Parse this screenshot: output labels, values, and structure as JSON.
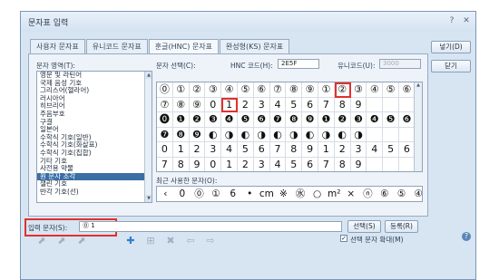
{
  "window": {
    "title": "문자표 입력",
    "help_icon": "?",
    "close_icon": "✕"
  },
  "tabs": [
    {
      "label": "사용자 문자표"
    },
    {
      "label": "유니코드 문자표"
    },
    {
      "label": "훈글(HNC) 문자표"
    },
    {
      "label": "완성형(KS) 문자표"
    }
  ],
  "area_label": "문자 영역(T):",
  "areas": [
    "영문 및 라틴어",
    "국제 음성 기호",
    "그리스어(헬라어)",
    "러시아어",
    "히브리어",
    "주음부호",
    "구결",
    "일본어",
    "수학식 기호(일반)",
    "수학식 기호(화살표)",
    "수학식 기호(집합)",
    "기타 기호",
    "사전용 약물",
    "원 문자 조각",
    "챌린 기호",
    "반각 기호(선)"
  ],
  "selected_area_index": 13,
  "char_select_label": "문자 선택(C):",
  "hnc_code_label": "HNC 코드(H):",
  "hnc_code_value": "2E5F",
  "unicode_label": "유니코드(U):",
  "unicode_value": "3000",
  "grid_rows": [
    [
      "⓪",
      "①",
      "②",
      "③",
      "④",
      "⑤",
      "⑥",
      "⑦",
      "⑧",
      "⑨",
      "①",
      "②",
      "③",
      "④",
      "⑤",
      "⑥"
    ],
    [
      "⑦",
      "⑧",
      "⑨",
      "0",
      "1",
      "2",
      "3",
      "4",
      "5",
      "6",
      "7",
      "8",
      "9",
      "",
      "",
      ""
    ],
    [
      "⓿",
      "❶",
      "❷",
      "❸",
      "❹",
      "❺",
      "❻",
      "❼",
      "❽",
      "❾",
      "❶",
      "❷",
      "❸",
      "❹",
      "❺",
      "❻"
    ],
    [
      "❼",
      "❽",
      "❾",
      "◐",
      "◑",
      "◐",
      "◑",
      "◐",
      "◑",
      "◐",
      "◑",
      "◐",
      "◑",
      "",
      "",
      ""
    ],
    [
      "0",
      "1",
      "2",
      "3",
      "4",
      "5",
      "6",
      "7",
      "8",
      "9",
      "1",
      "2",
      "3",
      "4",
      "5",
      "6"
    ],
    [
      "7",
      "8",
      "9",
      "0",
      "1",
      "2",
      "3",
      "4",
      "5",
      "6",
      "7",
      "8",
      "9",
      "",
      "",
      ""
    ]
  ],
  "grid_highlights": [
    [
      0,
      11
    ],
    [
      1,
      4
    ]
  ],
  "recent_label": "최근 사용한 문자(O):",
  "recent_chars": [
    "‹",
    "0",
    "⓪",
    "①",
    "6",
    "•",
    "cm",
    "※",
    "㊌",
    "○",
    "m²",
    "×",
    "ⓝ",
    "⑥",
    "⑤",
    "④"
  ],
  "input_label": "입력 문자(S):",
  "input_value": "⓪ 1",
  "buttons": {
    "insert": "넣기(D)",
    "close": "닫기",
    "select": "선택(S)",
    "register": "등록(R)"
  },
  "enlarge_label": "선택 문자 확대(M)",
  "enlarge_checked": "✓"
}
